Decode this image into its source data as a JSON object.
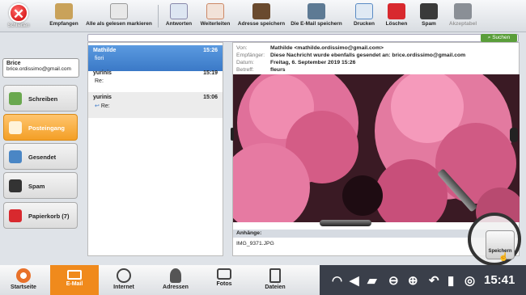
{
  "toolbar": {
    "close_label": "Schließen",
    "items": [
      {
        "label": "Empfangen"
      },
      {
        "label": "Alle als gelesen markieren"
      },
      {
        "label": "Antworten"
      },
      {
        "label": "Weiterleiten"
      },
      {
        "label": "Adresse speichern"
      },
      {
        "label": "Die E-Mail speichern"
      },
      {
        "label": "Drucken"
      },
      {
        "label": "Löschen"
      },
      {
        "label": "Spam"
      },
      {
        "label": "Akzeptabel"
      }
    ]
  },
  "search": {
    "button_label": "Suchen",
    "placeholder": ""
  },
  "account": {
    "name": "Brice",
    "email": "brice.ordissimo@gmail.com"
  },
  "folders": [
    {
      "label": "Schreiben"
    },
    {
      "label": "Posteingang"
    },
    {
      "label": "Gesendet"
    },
    {
      "label": "Spam"
    },
    {
      "label": "Papierkorb",
      "count": "(7)"
    }
  ],
  "messages": [
    {
      "from": "Mathilde",
      "time": "15:26",
      "subject": "fiori"
    },
    {
      "from": "yurinis",
      "time": "15:19",
      "subject": "Re:"
    },
    {
      "from": "yurinis",
      "time": "15:06",
      "subject": "Re:"
    }
  ],
  "preview": {
    "von_label": "Von:",
    "von": "Mathilde <mathilde.ordissimo@gmail.com>",
    "empf_label": "Empfänger:",
    "empf": "Diese Nachricht wurde ebenfalls gesendet an: brice.ordissimo@gmail.com",
    "datum_label": "Datum:",
    "datum": "Freitag, 6. September 2019 15:26",
    "betreff_label": "Betreff:",
    "betreff": "fleurs",
    "attachments_label": "Anhänge:",
    "attachment_file": "IMG_9371.JPG",
    "save_label": "Speichern"
  },
  "bottom_nav": [
    {
      "label": "Startseite"
    },
    {
      "label": "E-Mail"
    },
    {
      "label": "Internet"
    },
    {
      "label": "Adressen"
    },
    {
      "label": "Fotos"
    },
    {
      "label": "Dateien"
    }
  ],
  "status": {
    "clock": "15:41"
  },
  "colors": {
    "accent": "#f08a1c",
    "selected": "#3b79c7",
    "search_green": "#5a9e3a"
  }
}
